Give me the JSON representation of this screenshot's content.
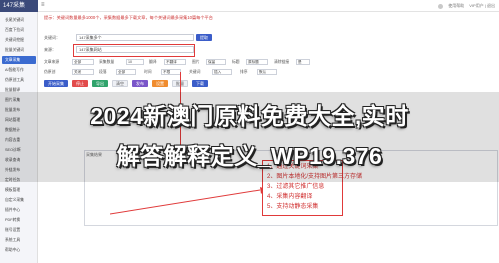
{
  "app": {
    "logo": "147采集",
    "menu_icon": "menu-icon"
  },
  "topbar": {
    "user": "VIP用户 | 退出",
    "help": "使用帮助"
  },
  "sidebar": {
    "items": [
      {
        "label": "长尾关键词"
      },
      {
        "label": "百度下拉词"
      },
      {
        "label": "关键词挖掘"
      },
      {
        "label": "批量关键词"
      },
      {
        "label": "文章采集"
      },
      {
        "label": "AI智能写作"
      },
      {
        "label": "伪原创工具"
      },
      {
        "label": "批量翻译"
      },
      {
        "label": "图片采集"
      },
      {
        "label": "批量发布"
      },
      {
        "label": "网站管理"
      },
      {
        "label": "数据统计"
      },
      {
        "label": "内容去重"
      },
      {
        "label": "SEO诊断"
      },
      {
        "label": "收录查询"
      },
      {
        "label": "外链发布"
      },
      {
        "label": "定时任务"
      },
      {
        "label": "模板管理"
      },
      {
        "label": "自定义采集"
      },
      {
        "label": "插件中心"
      },
      {
        "label": "PDF转换"
      },
      {
        "label": "账号设置"
      },
      {
        "label": "系统工具"
      },
      {
        "label": "帮助中心"
      }
    ]
  },
  "notice": "提示：关键词数量最多1000个，采集数据最多下载文章，每个关键词最多采集10篇每个平台",
  "form": {
    "keyword_label": "关键词：",
    "keyword_value": "147采集多个",
    "keyword_button": "提取",
    "source_label": "来源：",
    "source_value": "147采集网站",
    "lang_label": "语言：",
    "options": [
      {
        "label": "文章来源",
        "value": "全部"
      },
      {
        "label": "采集数量",
        "value": "10"
      },
      {
        "label": "翻译",
        "value": "不翻译"
      },
      {
        "label": "图片",
        "value": "保留"
      },
      {
        "label": "标题",
        "value": "原标题"
      },
      {
        "label": "清除链接",
        "value": "是"
      }
    ],
    "options2": [
      {
        "label": "伪原创",
        "value": "关闭"
      },
      {
        "label": "段落",
        "value": "全部"
      },
      {
        "label": "时间",
        "value": "不限"
      },
      {
        "label": "关键词",
        "value": "插入"
      },
      {
        "label": "排序",
        "value": "默认"
      }
    ],
    "buttons": [
      "开始采集",
      "停止",
      "导出",
      "清空",
      "发布",
      "设置",
      "批量",
      "下载"
    ]
  },
  "result_area": {
    "header": "采集结果"
  },
  "features": [
    "1、通过关键词采集",
    "2、图片本地化/支持图片第三方存储",
    "3、过滤其它推广信息",
    "4、采集内容翻译",
    "5、支持动静态采集"
  ],
  "overlay": {
    "line1": "2024新澳门原料免费大全,实时",
    "line2": "解答解释定义_WP19.376"
  }
}
